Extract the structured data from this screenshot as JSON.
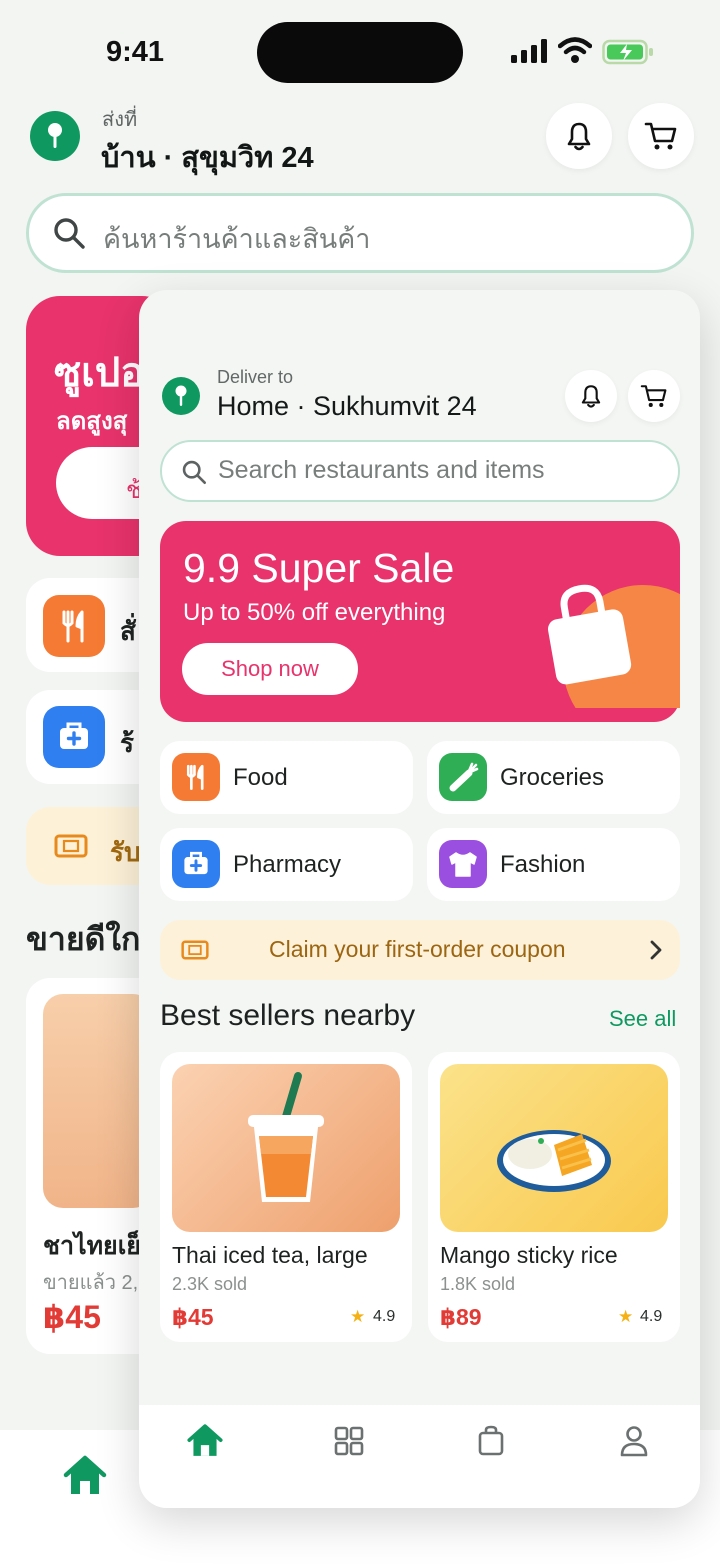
{
  "status_bar": {
    "time": "9:41"
  },
  "background_screen": {
    "header": {
      "deliver_label": "ส่งที่",
      "address": "บ้าน · สุขุมวิท 24"
    },
    "search": {
      "placeholder": "ค้นหาร้านค้าและสินค้า"
    },
    "banner": {
      "title": "ซูเปอ",
      "subtitle": "ลดสูงสุ",
      "button_label": "ช้"
    },
    "categories": [
      {
        "label": "สั่",
        "icon": "fork-knife-icon"
      },
      {
        "label": "ร้",
        "icon": "medkit-icon"
      }
    ],
    "coupon": {
      "text": "รับ"
    },
    "section_title": "ขายดีใก",
    "product": {
      "name": "ชาไทยเย็",
      "sold": "ขายแล้ว 2,",
      "price": "฿45"
    }
  },
  "app_card": {
    "header": {
      "deliver_label": "Deliver to",
      "address": "Home · Sukhumvit 24"
    },
    "search": {
      "placeholder": "Search restaurants and items"
    },
    "banner": {
      "title": "9.9 Super Sale",
      "subtitle": "Up to 50% off everything",
      "button_label": "Shop now"
    },
    "categories": [
      {
        "label": "Food",
        "icon": "fork-knife-icon",
        "color": "#f57a33"
      },
      {
        "label": "Groceries",
        "icon": "carrot-icon",
        "color": "#2fae55"
      },
      {
        "label": "Pharmacy",
        "icon": "medkit-icon",
        "color": "#2f7ff0"
      },
      {
        "label": "Fashion",
        "icon": "tshirt-icon",
        "color": "#9b4fe0"
      }
    ],
    "coupon": {
      "text": "Claim your first-order coupon"
    },
    "section": {
      "title": "Best sellers nearby",
      "see_all": "See all"
    },
    "products": [
      {
        "name": "Thai iced tea, large",
        "sold": "2.3K sold",
        "price": "฿45",
        "rating": "4.9",
        "icon": "iced-tea-icon"
      },
      {
        "name": "Mango sticky rice",
        "sold": "1.8K sold",
        "price": "฿89",
        "rating": "4.9",
        "icon": "mango-sticky-rice-icon"
      }
    ],
    "nav": [
      {
        "name": "home",
        "icon": "home-icon",
        "active": true
      },
      {
        "name": "categories",
        "icon": "grid-icon",
        "active": false
      },
      {
        "name": "orders",
        "icon": "bag-icon",
        "active": false
      },
      {
        "name": "profile",
        "icon": "user-icon",
        "active": false
      }
    ]
  },
  "colors": {
    "brand_green": "#0f9960",
    "sale_pink": "#e8336c",
    "price_red": "#e23a35",
    "coupon_bg": "#fdf1d9"
  }
}
